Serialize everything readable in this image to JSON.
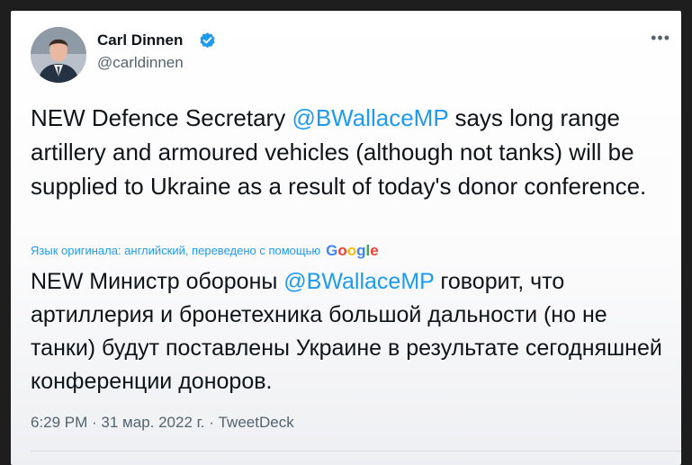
{
  "tweet": {
    "author": {
      "display_name": "Carl Dinnen",
      "handle": "@carldinnen",
      "verified": true
    },
    "more_label": "•••",
    "text": {
      "before_mention": "NEW Defence Secretary ",
      "mention": "@BWallaceMP",
      "after_mention": " says long range artillery and armoured vehicles (although not tanks) will be supplied to Ukraine as a result of today's donor conference."
    },
    "translation": {
      "note": "Язык оригинала: английский, переведено с помощью",
      "provider": {
        "g1": "G",
        "o1": "o",
        "o2": "o",
        "g2": "g",
        "l": "l",
        "e": "e"
      },
      "before_mention": "NEW Министр обороны ",
      "mention": "@BWallaceMP",
      "after_mention": " говорит, что артиллерия и бронетехника большой дальности (но не танки) будут поставлены Украине в результате сегодняшней конференции доноров."
    },
    "meta": {
      "time": "6:29 PM",
      "separator": " · ",
      "date": "31 мар. 2022 г.",
      "source": "TweetDeck"
    }
  },
  "colors": {
    "link": "#1d9bf0",
    "text": "#0f1419",
    "secondary": "#536471"
  },
  "icons": [
    "verified-badge-icon",
    "more-options-icon"
  ]
}
